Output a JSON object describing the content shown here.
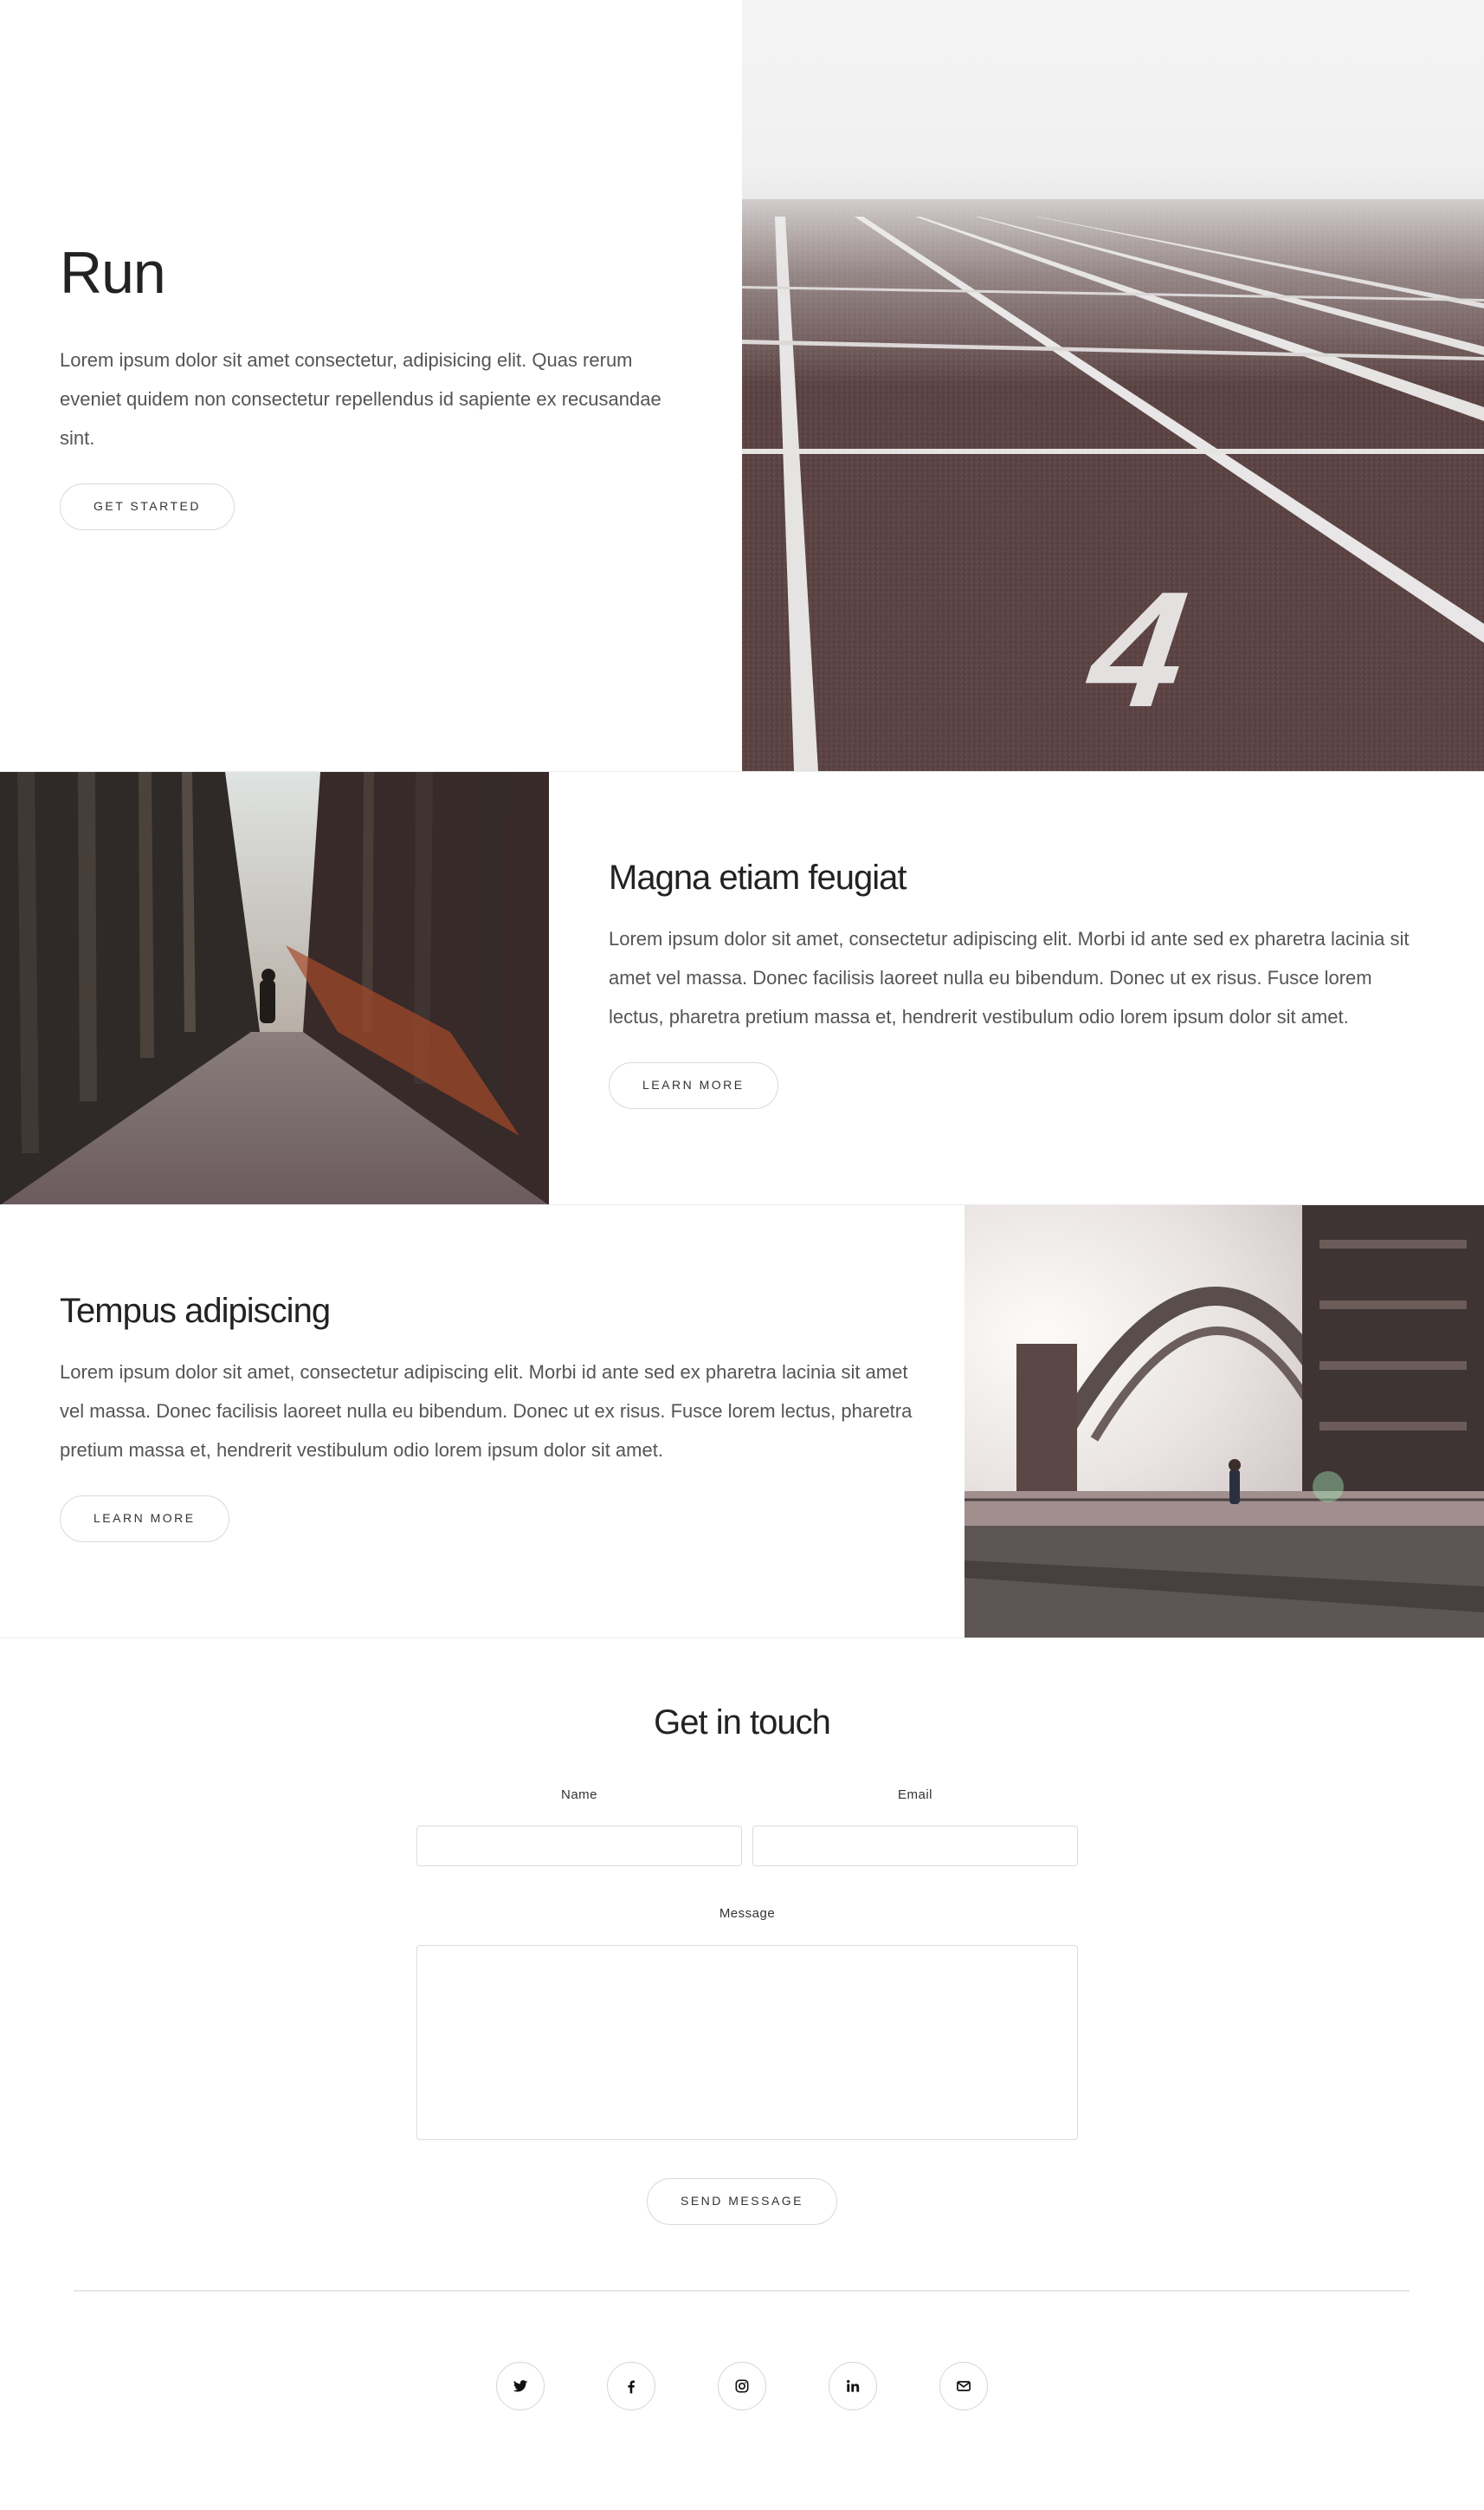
{
  "hero": {
    "title": "Run",
    "text": "Lorem ipsum dolor sit amet consectetur, adipisicing elit. Quas rerum eveniet quidem non consectetur repellendus id sapiente ex recusandae sint.",
    "button": "Get Started",
    "image_overlay_text": "4"
  },
  "features": [
    {
      "title": "Magna etiam feugiat",
      "text": "Lorem ipsum dolor sit amet, consectetur adipiscing elit. Morbi id ante sed ex pharetra lacinia sit amet vel massa. Donec facilisis laoreet nulla eu bibendum. Donec ut ex risus. Fusce lorem lectus, pharetra pretium massa et, hendrerit vestibulum odio lorem ipsum dolor sit amet.",
      "button": "Learn More"
    },
    {
      "title": "Tempus adipiscing",
      "text": "Lorem ipsum dolor sit amet, consectetur adipiscing elit. Morbi id ante sed ex pharetra lacinia sit amet vel massa. Donec facilisis laoreet nulla eu bibendum. Donec ut ex risus. Fusce lorem lectus, pharetra pretium massa et, hendrerit vestibulum odio lorem ipsum dolor sit amet.",
      "button": "Learn More"
    }
  ],
  "contact": {
    "title": "Get in touch",
    "name_label": "Name",
    "email_label": "Email",
    "message_label": "Message",
    "send_button": "Send Message"
  },
  "socials": [
    {
      "name": "twitter-icon"
    },
    {
      "name": "facebook-icon"
    },
    {
      "name": "instagram-icon"
    },
    {
      "name": "linkedin-icon"
    },
    {
      "name": "email-icon"
    }
  ],
  "colors": {
    "track": "#5e4444",
    "text": "#555555",
    "heading": "#222222",
    "border": "#dcdcdc"
  }
}
